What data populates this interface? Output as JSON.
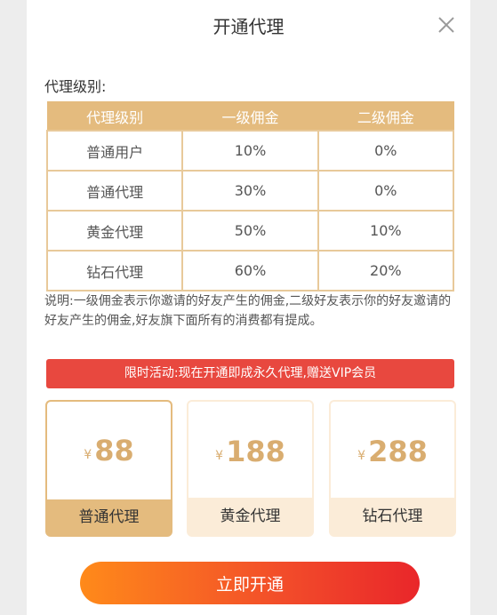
{
  "header": {
    "title": "开通代理",
    "close_icon": "close-icon"
  },
  "section_label": "代理级别:",
  "table": {
    "headers": [
      "代理级别",
      "一级佣金",
      "二级佣金"
    ],
    "rows": [
      [
        "普通用户",
        "10%",
        "0%"
      ],
      [
        "普通代理",
        "30%",
        "0%"
      ],
      [
        "黄金代理",
        "50%",
        "10%"
      ],
      [
        "钻石代理",
        "60%",
        "20%"
      ]
    ]
  },
  "note": "说明:一级佣金表示你邀请的好友产生的佣金,二级好友表示你的好友邀请的好友产生的佣金,好友旗下面所有的消费都有提成。",
  "promo": "限时活动:现在开通即成永久代理,赠送VIP会员",
  "plans": [
    {
      "currency": "¥",
      "price": "88",
      "name": "普通代理",
      "selected": true
    },
    {
      "currency": "¥",
      "price": "188",
      "name": "黄金代理",
      "selected": false
    },
    {
      "currency": "¥",
      "price": "288",
      "name": "钻石代理",
      "selected": false
    }
  ],
  "activate_label": "立即开通",
  "colors": {
    "gold": "#e4bb7e",
    "price": "#d9ad70",
    "promo": "#e8483f",
    "button_start": "#ff8a1a",
    "button_end": "#e9262a"
  }
}
